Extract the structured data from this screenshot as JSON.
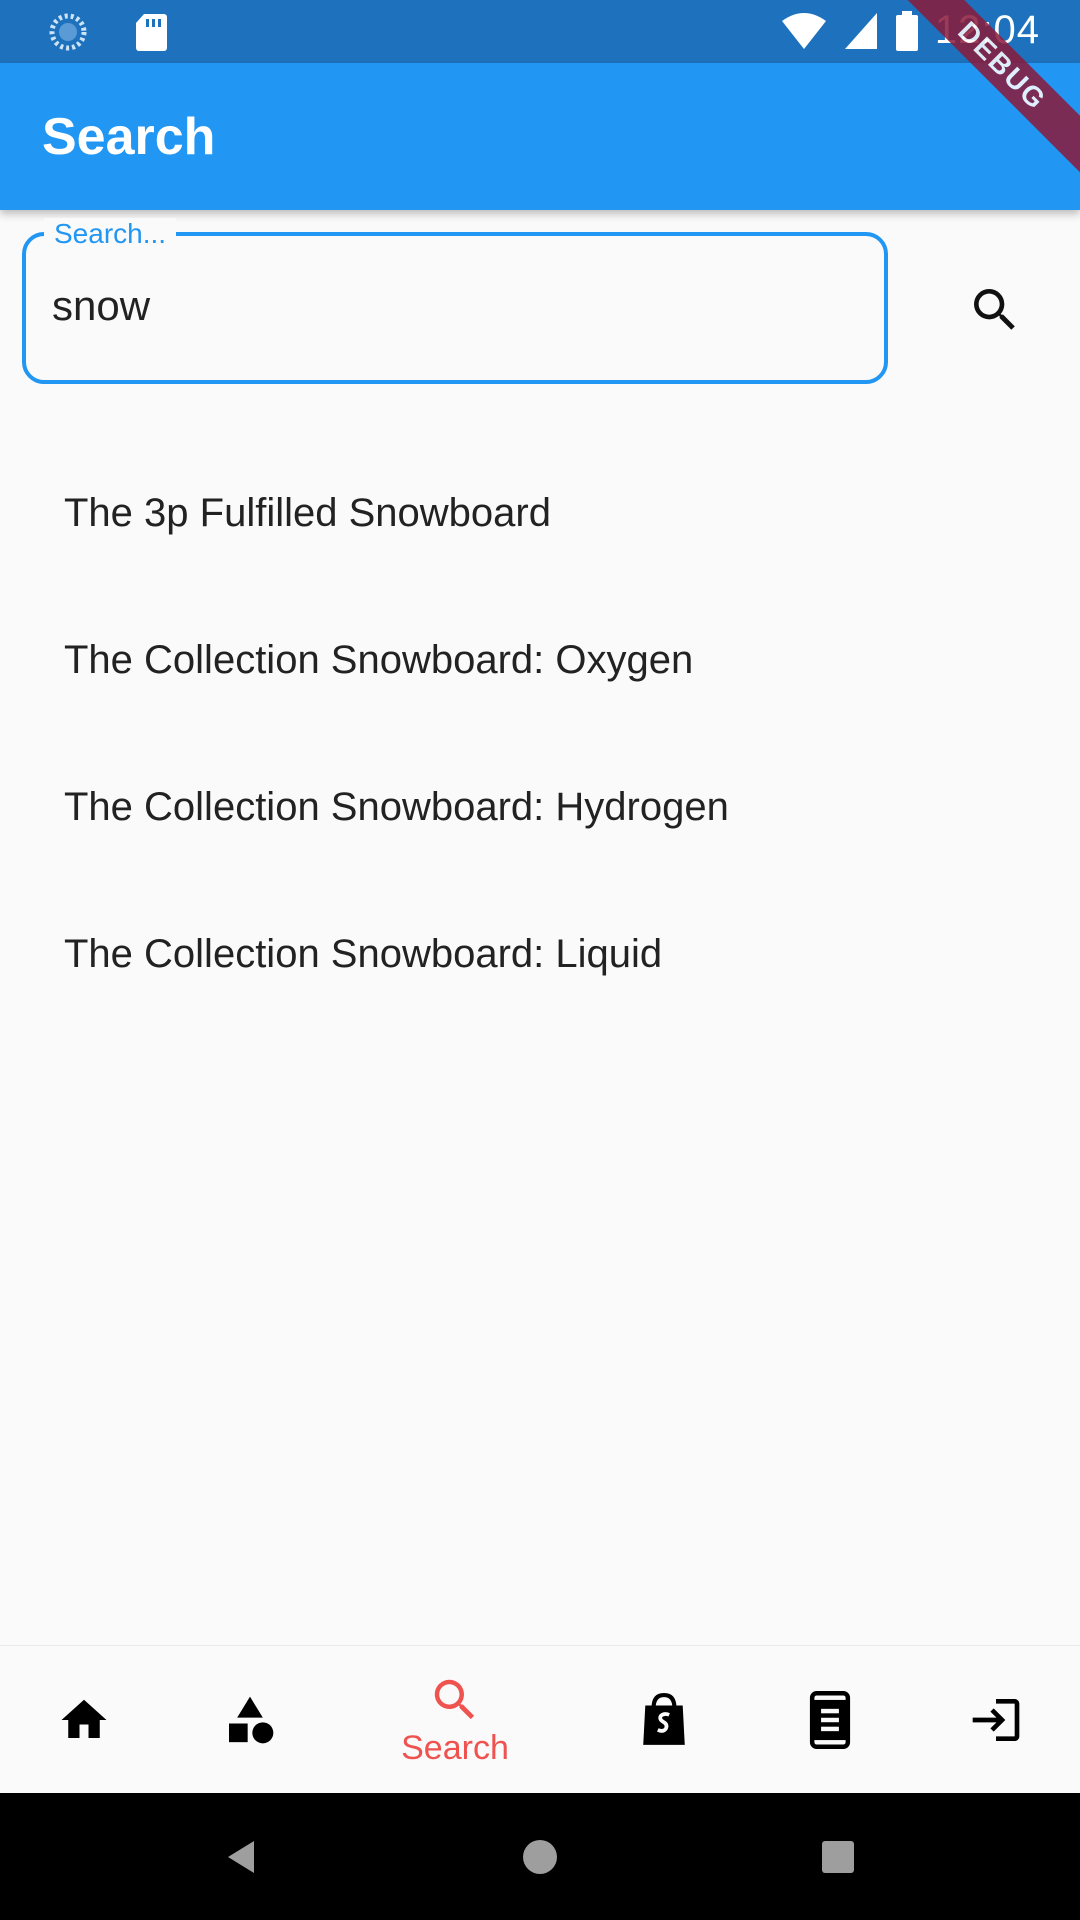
{
  "status_bar": {
    "time": "12:04",
    "left_icons": [
      "loading-icon",
      "sd-card-icon"
    ],
    "right_icons": [
      "wifi-icon",
      "signal-icon",
      "battery-icon"
    ]
  },
  "debug_banner": "DEBUG",
  "app_bar": {
    "title": "Search"
  },
  "search": {
    "label": "Search...",
    "value": "snow",
    "button_icon": "search-icon"
  },
  "results": [
    {
      "title": "The 3p Fulfilled Snowboard"
    },
    {
      "title": "The Collection Snowboard: Oxygen"
    },
    {
      "title": "The Collection Snowboard: Hydrogen"
    },
    {
      "title": "The Collection Snowboard: Liquid"
    }
  ],
  "bottom_nav": {
    "active_index": 2,
    "active_color": "#ef5350",
    "items": [
      {
        "icon": "home-icon",
        "label": ""
      },
      {
        "icon": "category-shapes-icon",
        "label": ""
      },
      {
        "icon": "search-icon",
        "label": "Search"
      },
      {
        "icon": "shopify-bag-icon",
        "label": ""
      },
      {
        "icon": "phone-list-icon",
        "label": ""
      },
      {
        "icon": "login-icon",
        "label": ""
      }
    ]
  },
  "system_nav": {
    "icons": [
      "back-icon",
      "home-circle-icon",
      "recents-icon"
    ]
  },
  "colors": {
    "status_bar": "#1e72bd",
    "app_bar": "#2196f3",
    "accent": "#2196f3",
    "background": "#fafafa"
  }
}
